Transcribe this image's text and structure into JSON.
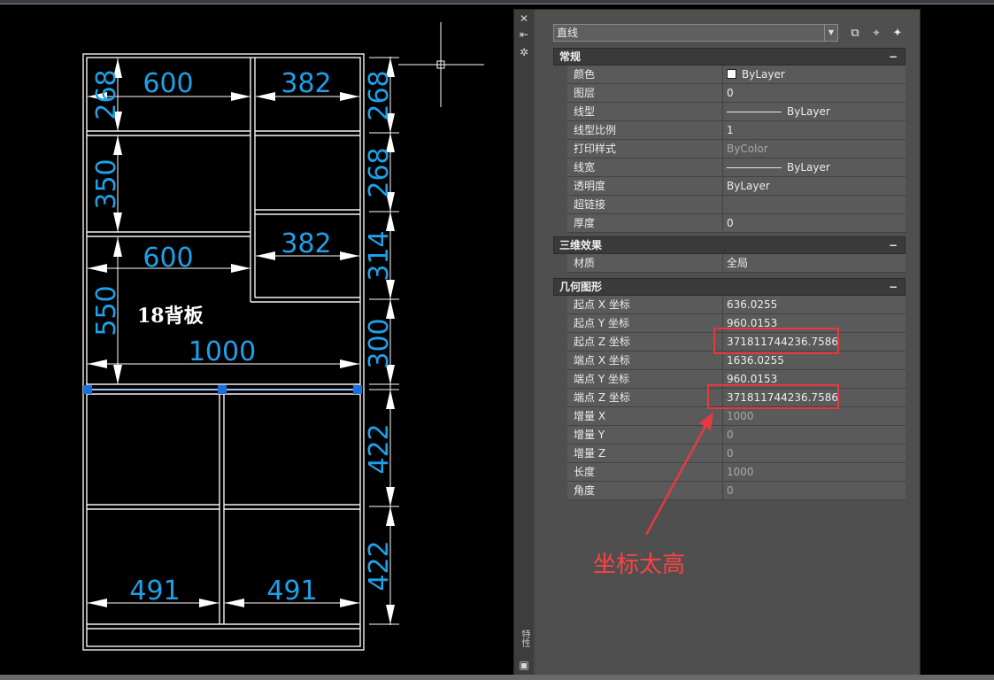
{
  "drawing": {
    "dims_top_horizontal": [
      "600",
      "382"
    ],
    "dims_mid_horizontal": [
      "600",
      "382"
    ],
    "dim_full_width": "1000",
    "dims_bottom_horizontal": [
      "491",
      "491"
    ],
    "dims_left_vertical": [
      "268",
      "350",
      "550"
    ],
    "dims_right_vertical": [
      "268",
      "268",
      "314",
      "300",
      "422",
      "422"
    ],
    "board_label": "18背板"
  },
  "palette": {
    "side_label": "特性",
    "object_type": "直线",
    "sections": [
      {
        "title": "常规",
        "collapse": "−",
        "rows": [
          {
            "key": "颜色",
            "value": "ByLayer"
          },
          {
            "key": "图层",
            "value": "0"
          },
          {
            "key": "线型",
            "value": "ByLayer"
          },
          {
            "key": "线型比例",
            "value": "1"
          },
          {
            "key": "打印样式",
            "value": "ByColor"
          },
          {
            "key": "线宽",
            "value": "ByLayer"
          },
          {
            "key": "透明度",
            "value": "ByLayer"
          },
          {
            "key": "超链接",
            "value": ""
          },
          {
            "key": "厚度",
            "value": "0"
          }
        ]
      },
      {
        "title": "三维效果",
        "collapse": "−",
        "rows": [
          {
            "key": "材质",
            "value": "全局"
          }
        ]
      },
      {
        "title": "几何图形",
        "collapse": "−",
        "rows": [
          {
            "key": "起点 X 坐标",
            "value": "636.0255"
          },
          {
            "key": "起点 Y 坐标",
            "value": "960.0153"
          },
          {
            "key": "起点 Z 坐标",
            "value": "371811744236.7586"
          },
          {
            "key": "端点 X 坐标",
            "value": "1636.0255"
          },
          {
            "key": "端点 Y 坐标",
            "value": "960.0153"
          },
          {
            "key": "端点 Z 坐标",
            "value": "371811744236.7586"
          },
          {
            "key": "增量 X",
            "value": "1000"
          },
          {
            "key": "增量 Y",
            "value": "0"
          },
          {
            "key": "增量 Z",
            "value": "0"
          },
          {
            "key": "长度",
            "value": "1000"
          },
          {
            "key": "角度",
            "value": "0"
          }
        ]
      }
    ]
  },
  "annotation": {
    "text": "坐标太高",
    "color": "#ff4040"
  },
  "colors": {
    "dimension": "#1fa0e8",
    "grip": "#1a6fe0",
    "highlight_box": "#e8383f"
  }
}
